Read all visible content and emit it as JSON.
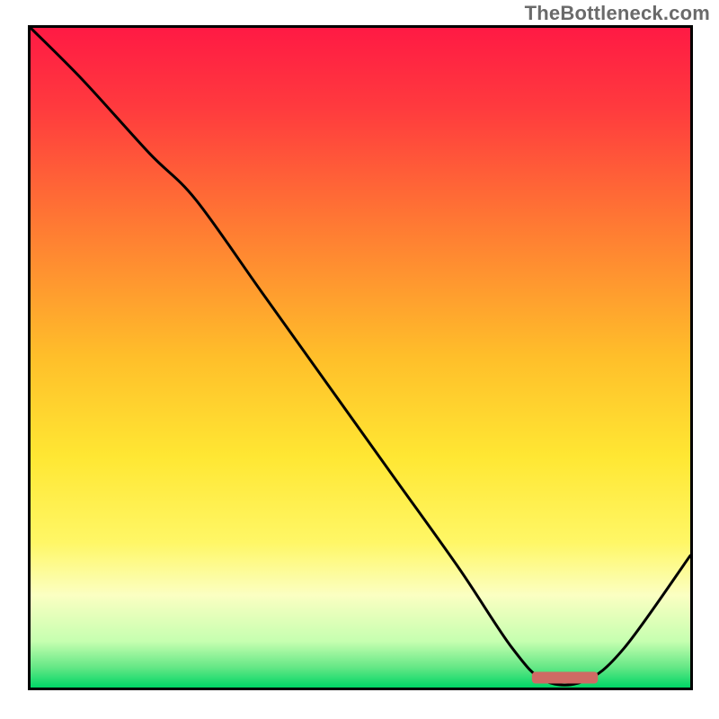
{
  "watermark": "TheBottleneck.com",
  "chart_data": {
    "type": "line",
    "title": "",
    "xlabel": "",
    "ylabel": "",
    "xlim": [
      0,
      100
    ],
    "ylim": [
      0,
      100
    ],
    "background_gradient": {
      "stops": [
        {
          "pct": 0,
          "color": "#ff1a44"
        },
        {
          "pct": 12,
          "color": "#ff3a3e"
        },
        {
          "pct": 30,
          "color": "#ff7a33"
        },
        {
          "pct": 50,
          "color": "#ffbf2a"
        },
        {
          "pct": 65,
          "color": "#ffe733"
        },
        {
          "pct": 78,
          "color": "#fff766"
        },
        {
          "pct": 86,
          "color": "#fbffc2"
        },
        {
          "pct": 93,
          "color": "#c6ffb0"
        },
        {
          "pct": 97,
          "color": "#63e785"
        },
        {
          "pct": 100,
          "color": "#00d666"
        }
      ]
    },
    "series": [
      {
        "name": "curve",
        "x": [
          0,
          8,
          18,
          25,
          35,
          45,
          55,
          65,
          73,
          78,
          84,
          90,
          100
        ],
        "y": [
          100,
          92,
          81,
          74,
          60,
          46,
          32,
          18,
          6,
          1,
          1,
          6,
          20
        ]
      }
    ],
    "marker": {
      "x_start": 76,
      "x_end": 86,
      "y": 1.5,
      "fill": "#cf6a64",
      "rx": 4
    }
  }
}
